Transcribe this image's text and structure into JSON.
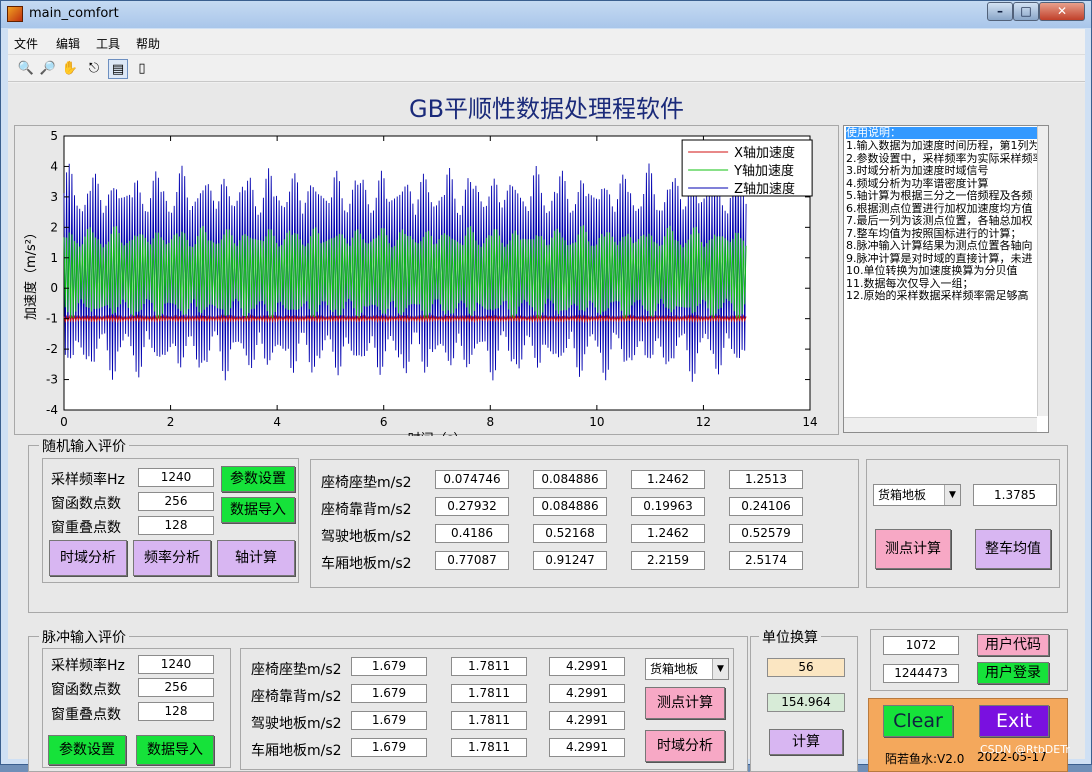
{
  "window": {
    "title": "main_comfort"
  },
  "menus": [
    "文件",
    "编辑",
    "工具",
    "帮助"
  ],
  "toolbar_icons": [
    "zoom-in-icon",
    "zoom-out-icon",
    "pan-icon",
    "data-cursor-icon",
    "legend-icon",
    "colorbar-icon"
  ],
  "app_title": "GB平顺性数据处理程软件",
  "chart_data": {
    "type": "line",
    "xlabel": "时间（s）",
    "ylabel": "加速度（m/s²）",
    "xlim": [
      0,
      14
    ],
    "ylim": [
      -4,
      5
    ],
    "xticks": [
      "0",
      "2",
      "4",
      "6",
      "8",
      "10",
      "12",
      "14"
    ],
    "yticks": [
      "-4",
      "-3",
      "-2",
      "-1",
      "0",
      "1",
      "2",
      "3",
      "4",
      "5"
    ],
    "legend_position": "top-right",
    "grid": false,
    "series": [
      {
        "name": "X轴加速度",
        "color": "#d01010",
        "x_range": [
          0,
          12.8
        ],
        "center": -1.0,
        "amplitude": 0.1
      },
      {
        "name": "Y轴加速度",
        "color": "#10c010",
        "x_range": [
          0,
          12.8
        ],
        "center": 0.5,
        "amplitude": 1.6
      },
      {
        "name": "Z轴加速度",
        "color": "#0000b0",
        "x_range": [
          0,
          12.8
        ],
        "center": 0.5,
        "amplitude": 3.6
      }
    ]
  },
  "instructions": {
    "title": "使用说明：",
    "lines": [
      "1.输入数据为加速度时间历程，第1列为",
      "2.参数设置中，采样频率为实际采样频率",
      "3.时域分析为加速度时域信号",
      "4.频域分析为功率谱密度计算",
      "5.轴计算为根据三分之一倍频程及各频",
      "6.根据测点位置进行加权加速度均方值",
      "7.最后一列为该测点位置，各轴总加权",
      "7.整车均值为按照国标进行的计算；",
      "8.脉冲输入计算结果为测点位置各轴向",
      "9.脉冲计算是对时域的直接计算，未进",
      "10.单位转换为加速度换算为分贝值",
      "11.数据每次仅导入一组；",
      "12.原始的采样数据采样频率需足够高"
    ]
  },
  "random": {
    "group_title": "随机输入评价",
    "params": [
      {
        "label": "采样频率Hz",
        "value": "1240"
      },
      {
        "label": "窗函数点数",
        "value": "256"
      },
      {
        "label": "窗重叠点数",
        "value": "128"
      }
    ],
    "btn_param": "参数设置",
    "btn_import": "数据导入",
    "btn_time": "时域分析",
    "btn_freq": "频率分析",
    "btn_axis": "轴计算",
    "rows": [
      {
        "label": "座椅座垫m/s2",
        "values": [
          "0.074746",
          "0.084886",
          "1.2462",
          "1.2513"
        ]
      },
      {
        "label": "座椅靠背m/s2",
        "values": [
          "0.27932",
          "0.084886",
          "0.19963",
          "0.24106"
        ]
      },
      {
        "label": "驾驶地板m/s2",
        "values": [
          "0.4186",
          "0.52168",
          "1.2462",
          "0.52579"
        ]
      },
      {
        "label": "车厢地板m/s2",
        "values": [
          "0.77087",
          "0.91247",
          "2.2159",
          "2.5174"
        ]
      }
    ],
    "location_select": "货箱地板",
    "location_value": "1.3785",
    "btn_point": "测点计算",
    "btn_vehicle": "整车均值"
  },
  "pulse": {
    "group_title": "脉冲输入评价",
    "params": [
      {
        "label": "采样频率Hz",
        "value": "1240"
      },
      {
        "label": "窗函数点数",
        "value": "256"
      },
      {
        "label": "窗重叠点数",
        "value": "128"
      }
    ],
    "btn_param": "参数设置",
    "btn_import": "数据导入",
    "rows": [
      {
        "label": "座椅座垫m/s2",
        "values": [
          "1.679",
          "1.7811",
          "4.2991"
        ]
      },
      {
        "label": "座椅靠背m/s2",
        "values": [
          "1.679",
          "1.7811",
          "4.2991"
        ]
      },
      {
        "label": "驾驶地板m/s2",
        "values": [
          "1.679",
          "1.7811",
          "4.2991"
        ]
      },
      {
        "label": "车厢地板m/s2",
        "values": [
          "1.679",
          "1.7811",
          "4.2991"
        ]
      }
    ],
    "location_select": "货箱地板",
    "btn_point": "测点计算",
    "btn_time": "时域分析"
  },
  "unit": {
    "group_title": "单位换算",
    "value1": "56",
    "value2": "154.964",
    "btn_calc": "计算"
  },
  "user": {
    "code_value": "1072",
    "login_value": "1244473",
    "btn_code": "用户代码",
    "btn_login": "用户登录"
  },
  "footer": {
    "btn_clear": "Clear",
    "btn_exit": "Exit",
    "author": "陌若鱼水:V2.0",
    "date": "2022-05-17",
    "watermark": "CSDN @RtbDETr"
  },
  "colors": {
    "green_button": "#16e23a",
    "lavender_button": "#d8b6f2",
    "pink_button": "#f7a8c5",
    "exit_button": "#7a10e0",
    "footer_panel": "#f4a85c",
    "title_text": "#1a2a7a"
  }
}
